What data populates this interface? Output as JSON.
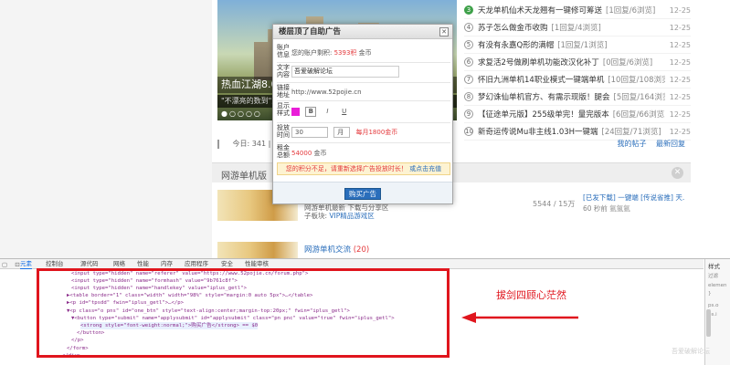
{
  "banner": {
    "caption": "热血江湖8.0外",
    "subcaption": "\"不漂亮的数到\"正",
    "dots": "●○○○○"
  },
  "news": [
    {
      "num": "3",
      "hot": true,
      "title": "天龙单机仙术天龙翘有一键修可筹送",
      "tag": "[1回复/6浏览]",
      "date": "12-25"
    },
    {
      "num": "4",
      "hot": false,
      "title": "苏子怎么做金币收购",
      "tag": "[1回复/4浏览]",
      "date": "12-25"
    },
    {
      "num": "5",
      "hot": false,
      "title": "有没有永嘉Q形的满帽",
      "tag": "[1回复/1浏览]",
      "date": "12-25"
    },
    {
      "num": "6",
      "hot": false,
      "title": "求复活2号做刷单机功能改汉化补丁",
      "tag": "[0回复/6浏览]",
      "date": "12-25"
    },
    {
      "num": "7",
      "hot": false,
      "title": "怀旧九洲单机14职业模式一键端单机",
      "tag": "[10回复/108浏览]",
      "date": "12-25"
    },
    {
      "num": "8",
      "hot": false,
      "title": "梦幻诛仙单机官方、有需示现版！腿会",
      "tag": "[5回复/164浏览]",
      "date": "12-25"
    },
    {
      "num": "9",
      "hot": false,
      "title": "【征途单元版】255级单完！量完版本",
      "tag": "[6回复/66浏览]",
      "date": "12-25"
    },
    {
      "num": "10",
      "hot": false,
      "title": "新奇运传说Mu非主线1.03H一键端",
      "tag": "[24回复/71浏览]",
      "date": "12-25"
    }
  ],
  "stats": {
    "text": "今日: 341 | 昨",
    "links": [
      "我的帖子",
      "最新回复"
    ]
  },
  "section": {
    "name": "网游单机版",
    "close": "✕"
  },
  "forums": [
    {
      "name": "",
      "count": "",
      "desc": "网游单机最新 下载与分享区",
      "mod_label": "子板块:",
      "mod": "VIP精品游戏区",
      "stat": "5544 / 15万",
      "last": "[已发下载] 一键端 [传说省推] 天...",
      "last2": "60 秒前 氩氩氩"
    },
    {
      "name": "网游单机交流",
      "count": "(20)",
      "desc": "",
      "mod_label": "",
      "mod": "",
      "stat": "",
      "last": "",
      "last2": ""
    }
  ],
  "dialog": {
    "title": "楼层顶了自助广告",
    "close": "✕",
    "rows": [
      {
        "label": "账户信息",
        "text": "您的账户剩积:",
        "red": "5393积",
        "suffix": "金币"
      },
      {
        "label": "文字内容",
        "input": "吾爱破解论坛"
      },
      {
        "label": "链接地址",
        "text": "http://www.52pojie.cn"
      },
      {
        "label": "显示样式",
        "bold": "B",
        "italic": "I",
        "underline": "U"
      },
      {
        "label": "投放时间",
        "sel1": "30",
        "sel2": "月",
        "red": "每月1800金币"
      },
      {
        "label": "租金总额",
        "red": "54000",
        "suffix": "金币"
      }
    ],
    "warning": "您的积分不足，请重新选择广告投放时长！",
    "warning_link": "或点击充值",
    "buy": "购买广告"
  },
  "devtools": {
    "toolbar_icons": "▢ ⊡",
    "tabs": [
      "元素",
      "控制台",
      "源代码",
      "网络",
      "性能",
      "内存",
      "应用程序",
      "安全",
      "性能审核"
    ],
    "lines": [
      "<input type=\"hidden\" name=\"referer\" value=\"https://www.52pojie.cn/forum.php\">",
      "<input type=\"hidden\" name=\"formhash\" value=\"9b761c8f\">",
      "<input type=\"hidden\" name=\"handlekey\" value=\"iplus_getl\">",
      "▶<table border=\"1\" class=\"width\" width=\"98%\" style=\"margin:0 auto 5px\">…</table>",
      "▶<p id=\"tpsdd\" fwin=\"iplus_getl\">…</p>",
      "▼<p class=\"o pns\" id=\"one_btn\" style=\"text-align:center;margin-top:20px;\" fwin=\"iplus_getl\">",
      "▼<button type=\"submit\" name=\"applysubmit\" id=\"applysubmit\" class=\"pn pnc\" value=\"true\" fwin=\"iplus_getl\">",
      "<strong style=\"font-weight:normal;\">购买广告</strong> == $0",
      "</button>",
      "</p>",
      "</form>",
      "</div>"
    ],
    "side_label": "样式",
    "side_sub": [
      "过滤",
      "elemen",
      "}",
      "ps.o",
      "ps.i"
    ]
  },
  "annotation": {
    "note": "拔剑四顾心茫然"
  },
  "watermark": "吾爱破解论坛"
}
